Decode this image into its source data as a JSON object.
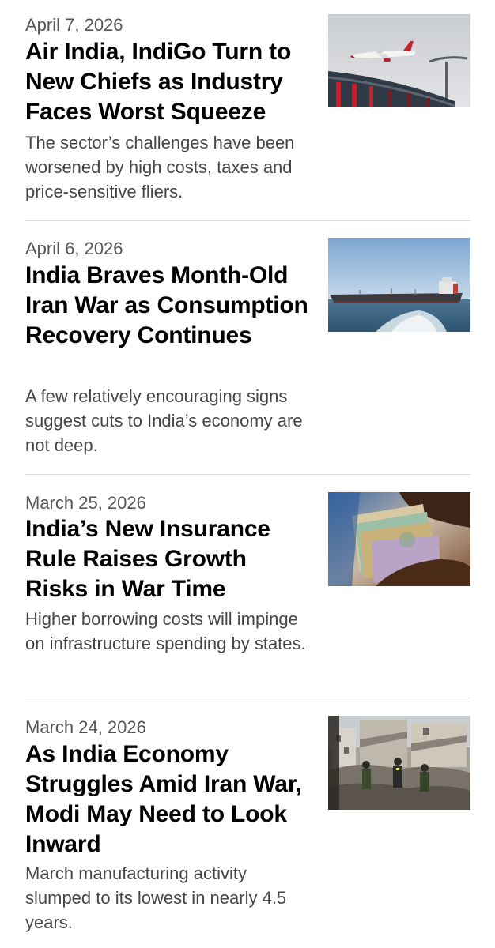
{
  "articles": [
    {
      "date": "April 7, 2026",
      "headline": "Air India, IndiGo Turn to New Chiefs as Industry Faces Worst Squeeze",
      "summary": "The sector’s challenges have been worsened by high costs, taxes and price-sensitive fliers.",
      "image": "airplane-photo"
    },
    {
      "date": "April 6, 2026",
      "headline": "India Braves Month-Old Iran War as Consumption Recovery Continues",
      "summary": "A few relatively encouraging signs suggest cuts to India’s economy are not deep.",
      "image": "oil-tanker-photo"
    },
    {
      "date": "March 25, 2026",
      "headline": "India’s New Insurance Rule Raises Growth Risks in War Time",
      "summary": "Higher borrowing costs will impinge on infrastructure spending by states.",
      "image": "currency-notes-photo"
    },
    {
      "date": "March 24, 2026",
      "headline": "As India Economy Struggles Amid Iran War, Modi May Need to Look Inward",
      "summary": "March manufacturing activity slumped to its lowest in nearly 4.5 years.",
      "image": "rubble-rescue-photo"
    }
  ]
}
